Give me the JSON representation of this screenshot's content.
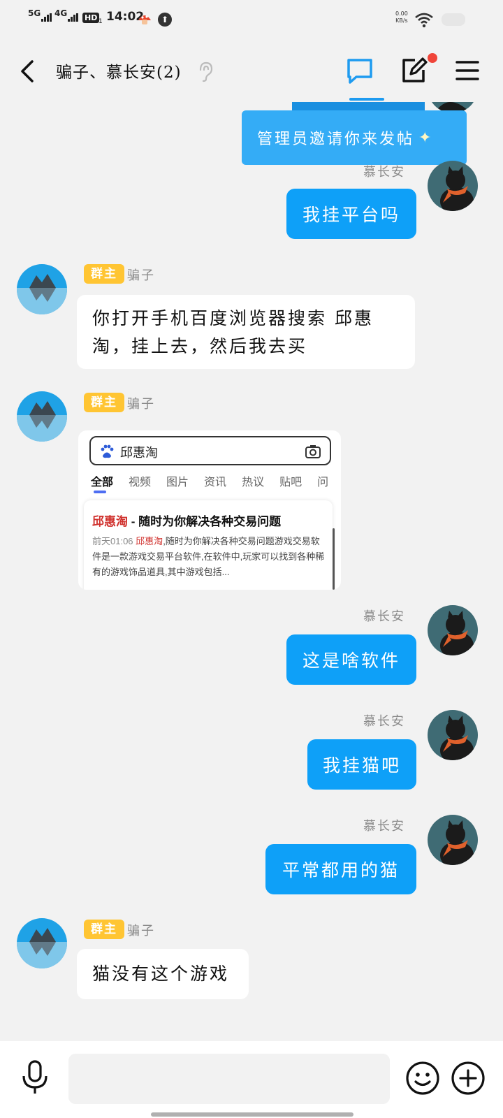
{
  "status_bar": {
    "signal1_label": "5G",
    "signal2_label": "4G",
    "hd_label": "HD",
    "hd_sub": "1",
    "time": "14:02",
    "speed_value": "0.00",
    "speed_unit": "KB/s",
    "icons": [
      "signal-icon",
      "signal-icon",
      "hd-icon",
      "mushroom-icon",
      "upload-icon",
      "wifi-icon",
      "battery-icon"
    ]
  },
  "header": {
    "title": "骗子、慕长安(2)",
    "icons": [
      "back-icon",
      "hearing-icon",
      "chat-icon",
      "edit-icon",
      "menu-icon"
    ],
    "accent": "#1e9bf0",
    "notification_color": "#f0453a"
  },
  "banner": {
    "text": "管理员邀请你来发帖",
    "sparkle": "✦"
  },
  "messages": [
    {
      "side": "right",
      "sender": "慕长安",
      "text": "我挂平台吗"
    },
    {
      "side": "left",
      "badge": "群主",
      "sender": "骗子",
      "text": "你打开手机百度浏览器搜索  邱惠淘，挂上去，然后我去买"
    },
    {
      "side": "left",
      "badge": "群主",
      "sender": "骗子",
      "type": "image"
    },
    {
      "side": "right",
      "sender": "慕长安",
      "text": "这是啥软件"
    },
    {
      "side": "right",
      "sender": "慕长安",
      "text": "我挂猫吧"
    },
    {
      "side": "right",
      "sender": "慕长安",
      "text": "平常都用的猫"
    },
    {
      "side": "left",
      "badge": "群主",
      "sender": "骗子",
      "text": "猫没有这个游戏"
    }
  ],
  "screenshot_card": {
    "query": "邱惠淘",
    "tabs": [
      "全部",
      "视频",
      "图片",
      "资讯",
      "热议",
      "贴吧",
      "问"
    ],
    "result_title_hl": "邱惠淘",
    "result_title_rest": " - 随时为你解决各种交易问题",
    "result_date": "前天01:06",
    "result_hl": "邱惠淘",
    "result_body": ",随时为你解决各种交易问题游戏交易软件是一款游戏交易平台软件,在软件中,玩家可以找到各种稀有的游戏饰品道具,其中游戏包括..."
  },
  "colors": {
    "outgoing_bubble": "#0ea0f8",
    "incoming_bubble": "#ffffff",
    "badge": "#ffc533",
    "background": "#f2f2f2"
  },
  "input_bar": {
    "icons": [
      "microphone-icon",
      "emoji-icon",
      "add-icon"
    ],
    "value": ""
  }
}
